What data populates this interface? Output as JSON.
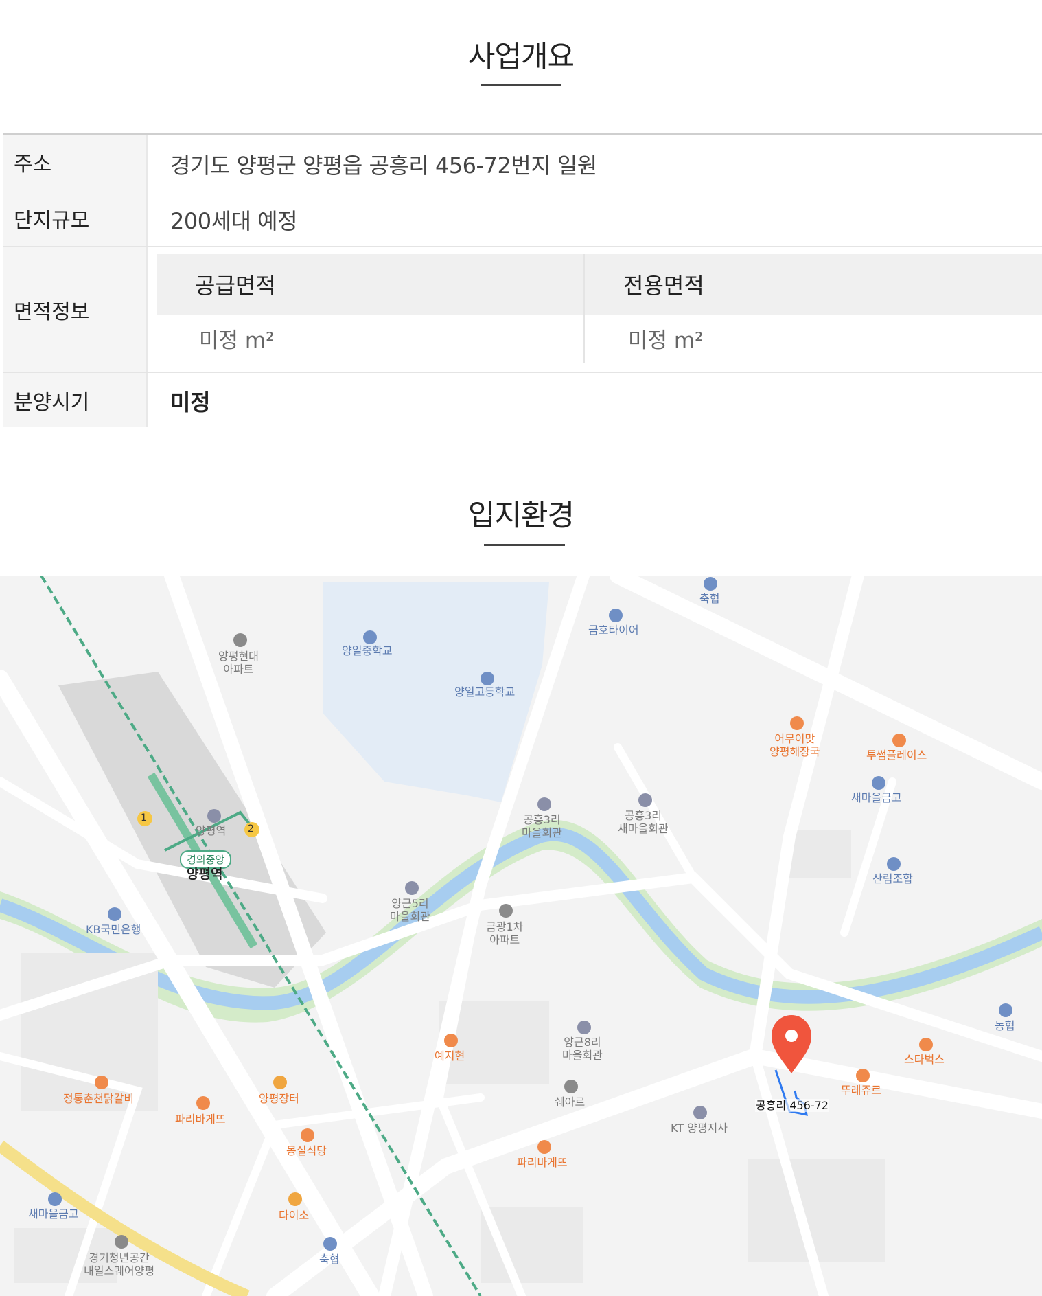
{
  "overview": {
    "title": "사업개요",
    "rows": {
      "address": {
        "label": "주소",
        "value": "경기도 양평군 양평읍 공흥리 456-72번지 일원"
      },
      "scale": {
        "label": "단지규모",
        "value": "200세대 예정"
      },
      "area": {
        "label": "면적정보",
        "supply_label": "공급면적",
        "supply_value": "미정 m²",
        "exclusive_label": "전용면적",
        "exclusive_value": "미정 m²"
      },
      "sale": {
        "label": "분양시기",
        "value": "미정"
      }
    }
  },
  "location": {
    "title": "입지환경",
    "map": {
      "station": {
        "line_badge": "경의중앙",
        "name": "양평역",
        "small_label": "양평역",
        "exit1": "1",
        "exit2": "2"
      },
      "pin_label": "공흥리 456-72",
      "pois": {
        "yangpyeong_hyundai": "양평현대\n아파트",
        "yangil_middle": "양일중학교",
        "yangil_high": "양일고등학교",
        "kumho_tire": "금호타이어",
        "chukhyup_top": "축협",
        "eomuimat": "어무이맛\n양평해장국",
        "twosome": "투썸플레이스",
        "saemaeul_right": "새마을금고",
        "gongheung3_hall": "공흥3리\n마을회관",
        "gongheung3_saemaeul": "공흥3리\n새마을회관",
        "sanlim": "산림조합",
        "yanggeun5": "양근5리\n마을회관",
        "geumgwang": "금광1차\n아파트",
        "kb": "KB국민은행",
        "nonghyup": "농협",
        "starbucks": "스타벅스",
        "touslesjours": "뚜레쥬르",
        "yejihyun": "예지현",
        "yanggeun8": "양근8리\n마을회관",
        "sheare": "쉐아르",
        "kt": "KT 양평지사",
        "jeongtong": "정통춘천닭갈비",
        "paris_left": "파리바게뜨",
        "market": "양평장터",
        "mongsil": "몽실식당",
        "paris_center": "파리바게뜨",
        "saemaeul_left": "새마을금고",
        "daiso": "다이소",
        "youth_space": "경기청년공간\n내일스퀘어양평",
        "chukhyup_bottom": "축협"
      },
      "colors": {
        "river": "#a7cdf0",
        "riverbank": "#cfe8c3",
        "road": "#ffffff",
        "rail": "#4daa86",
        "pin": "#f0553d"
      }
    }
  }
}
